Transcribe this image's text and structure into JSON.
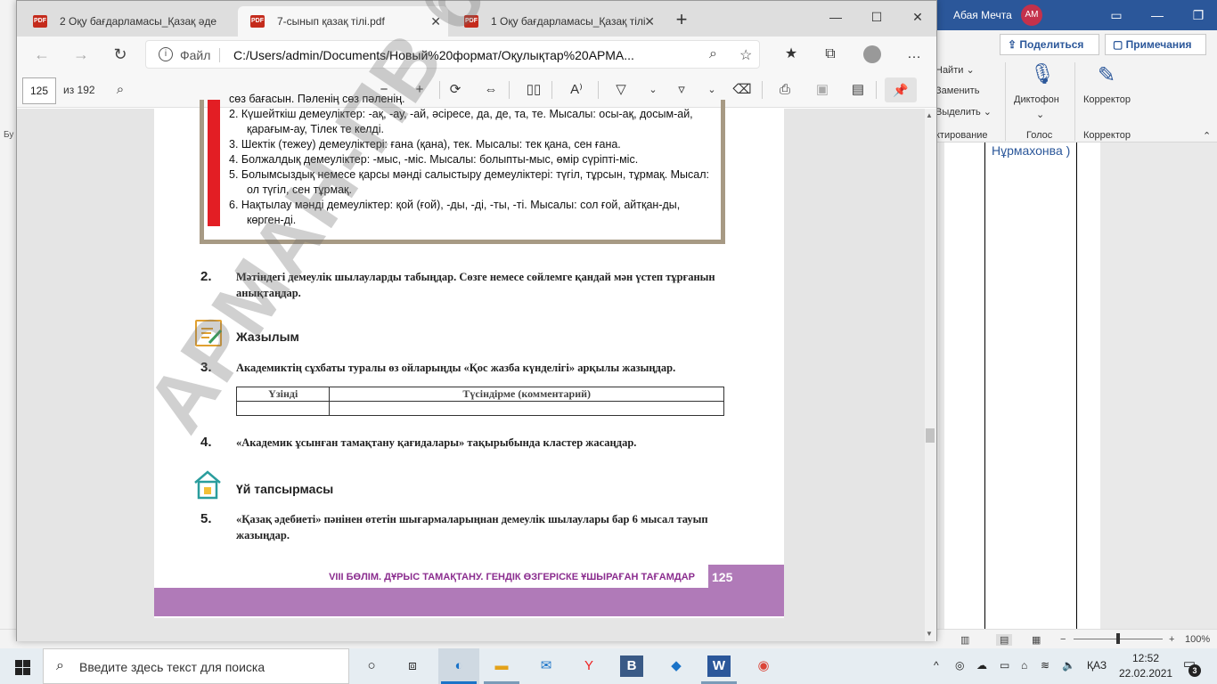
{
  "word": {
    "account_name": "Абая Мечта",
    "avatar_initials": "AM",
    "share_label": "Поделиться",
    "comments_label": "Примечания",
    "ribbon": {
      "find": "Найти",
      "replace": "Заменить",
      "select": "Выделить",
      "editing_group": "ктирование",
      "dictate": "Диктофон",
      "voice_group": "Голос",
      "editor": "Корректор",
      "editor_group": "Корректор"
    },
    "left_cut_label": "Бу",
    "doc_name_text": "Нұрмахонва )",
    "zoom": "100%"
  },
  "edge": {
    "tabs": [
      {
        "label": "2 Оқу бағдарламасы_Қазақ әде"
      },
      {
        "label": "7-сынып қазақ тілі.pdf"
      },
      {
        "label": "1 Оқу бағдарламасы_Қазақ тілі"
      }
    ],
    "pdf_badge": "PDF",
    "url_label": "Файл",
    "url": "C:/Users/admin/Documents/Новый%20формат/Оқулықтар%20АРМА...",
    "page_current": "125",
    "page_total": "из 192"
  },
  "pdf": {
    "list_items": [
      "сөз бағасын. Пәленің сөз пәленің.",
      "2.  Күшейткіш демеуліктер: -ақ, -ау, -ай, әсіресе, да, де, та, те. Мысалы: осы-ақ, досым-ай, қарағым-ау, Тілек те келді.",
      "3.  Шектік (тежеу) демеуліктері: ғана (қана), тек. Мысалы: тек қана, сен ғана.",
      "4.  Болжалдық демеуліктер: -мыс, -міс. Мысалы: болыпты-мыс, өмір сүріпті-міс.",
      "5.  Болымсыздық немесе қарсы мәнді салыстыру демеуліктері: түгіл, тұрсын, тұрмақ. Мысал: ол түгіл, сен тұрмақ.",
      "6.  Нақтылау мәнді демеуліктер: қой (ғой), -ды, -ді, -ты, -ті. Мысалы: сол ғой, айтқан-ды, көрген-ді."
    ],
    "task2_num": "2.",
    "task2_text": "Мәтіндегі демеулік шылауларды табыңдар. Сөзге немесе сөйлемге қандай мән үстеп тұрғанын анықтаңдар.",
    "heading_writing": "Жазылым",
    "task3_num": "3.",
    "task3_text": "Академиктің сұхбаты туралы өз ойларыңды «Қос жазба күнделігі» арқылы жазыңдар.",
    "table_headers": [
      "Үзінді",
      "Түсіндірме (комментарий)"
    ],
    "task4_num": "4.",
    "task4_text": "«Академик ұсынған тамақтану қағидалары» тақырыбында кластер жасаңдар.",
    "heading_homework": "Үй тапсырмасы",
    "task5_num": "5.",
    "task5_text": "«Қазақ әдебиеті» пәнінен өтетін шығармаларыңнан демеулік шылаулары бар 6 мысал тауып жазыңдар.",
    "footer_text": "VIII БӨЛІМ. ДҰРЫС ТАМАҚТАНУ. ГЕНДІК ӨЗГЕРІСКЕ ҰШЫРАҒАН ТАҒАМДАР",
    "page_number": "125",
    "watermark": "АРМАН-ПВ баспасы"
  },
  "taskbar": {
    "search_placeholder": "Введите здесь текст для поиска",
    "lang": "ҚАЗ",
    "time": "12:52",
    "date": "22.02.2021",
    "notif_count": "3"
  },
  "colors": {
    "accent": "#2b579a",
    "pdf_red": "#e31e24",
    "band": "#b07ab8"
  }
}
